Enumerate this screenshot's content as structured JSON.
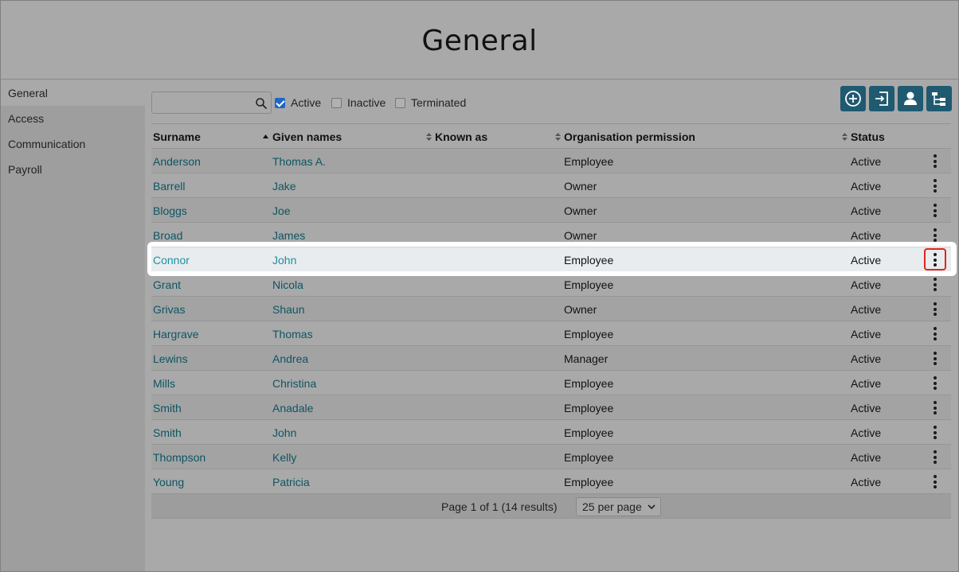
{
  "header": {
    "title": "General"
  },
  "sidebar": {
    "items": [
      {
        "label": "General",
        "active": true
      },
      {
        "label": "Access",
        "active": false
      },
      {
        "label": "Communication",
        "active": false
      },
      {
        "label": "Payroll",
        "active": false
      }
    ]
  },
  "toolbar": {
    "search": {
      "value": "",
      "placeholder": "",
      "icon": "search-icon"
    },
    "filters": [
      {
        "label": "Active",
        "checked": true
      },
      {
        "label": "Inactive",
        "checked": false
      },
      {
        "label": "Terminated",
        "checked": false
      }
    ],
    "buttons": [
      {
        "icon": "add-circle-icon"
      },
      {
        "icon": "import-icon"
      },
      {
        "icon": "person-icon"
      },
      {
        "icon": "hierarchy-icon"
      }
    ],
    "button_color": "#1f5a70"
  },
  "table": {
    "columns": [
      "Surname",
      "Given names",
      "Known as",
      "Organisation permission",
      "Status"
    ],
    "sorted_column": "Given names",
    "rows": [
      {
        "surname": "Anderson",
        "given": "Thomas A.",
        "known": "",
        "permission": "Employee",
        "status": "Active"
      },
      {
        "surname": "Barrell",
        "given": "Jake",
        "known": "",
        "permission": "Owner",
        "status": "Active"
      },
      {
        "surname": "Bloggs",
        "given": "Joe",
        "known": "",
        "permission": "Owner",
        "status": "Active"
      },
      {
        "surname": "Broad",
        "given": "James",
        "known": "",
        "permission": "Owner",
        "status": "Active"
      },
      {
        "surname": "Connor",
        "given": "John",
        "known": "",
        "permission": "Employee",
        "status": "Active",
        "highlighted": true
      },
      {
        "surname": "Grant",
        "given": "Nicola",
        "known": "",
        "permission": "Employee",
        "status": "Active"
      },
      {
        "surname": "Grivas",
        "given": "Shaun",
        "known": "",
        "permission": "Owner",
        "status": "Active"
      },
      {
        "surname": "Hargrave",
        "given": "Thomas",
        "known": "",
        "permission": "Employee",
        "status": "Active"
      },
      {
        "surname": "Lewins",
        "given": "Andrea",
        "known": "",
        "permission": "Manager",
        "status": "Active"
      },
      {
        "surname": "Mills",
        "given": "Christina",
        "known": "",
        "permission": "Employee",
        "status": "Active"
      },
      {
        "surname": "Smith",
        "given": "Anadale",
        "known": "",
        "permission": "Employee",
        "status": "Active"
      },
      {
        "surname": "Smith",
        "given": "John",
        "known": "",
        "permission": "Employee",
        "status": "Active"
      },
      {
        "surname": "Thompson",
        "given": "Kelly",
        "known": "",
        "permission": "Employee",
        "status": "Active"
      },
      {
        "surname": "Young",
        "given": "Patricia",
        "known": "",
        "permission": "Employee",
        "status": "Active"
      }
    ],
    "link_color": "#0d5562",
    "highlight_color": "#e0251b"
  },
  "footer": {
    "page_info": "Page 1 of 1 (14 results)",
    "per_page": "25 per page"
  }
}
